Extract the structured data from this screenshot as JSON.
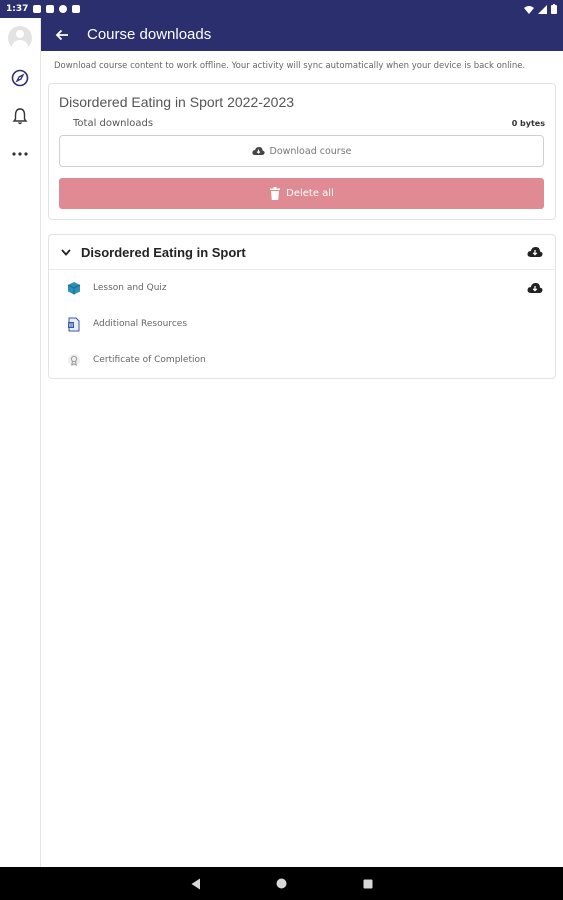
{
  "status_bar": {
    "time": "1:37"
  },
  "app_bar": {
    "title": "Course downloads"
  },
  "intro_text": "Download course content to work offline. Your activity will sync automatically when your device is back online.",
  "course": {
    "title": "Disordered Eating in Sport 2022-2023",
    "total_label": "Total downloads",
    "total_value": "0 bytes",
    "download_label": "Download course",
    "delete_label": "Delete all"
  },
  "section": {
    "title": "Disordered Eating in Sport",
    "modules": [
      {
        "label": "Lesson and Quiz",
        "icon": "package-icon",
        "downloadable": true
      },
      {
        "label": "Additional Resources",
        "icon": "document-icon",
        "downloadable": false
      },
      {
        "label": "Certificate of Completion",
        "icon": "certificate-icon",
        "downloadable": false
      }
    ]
  },
  "colors": {
    "primary": "#2b2f6e",
    "danger": "#e08b93"
  }
}
